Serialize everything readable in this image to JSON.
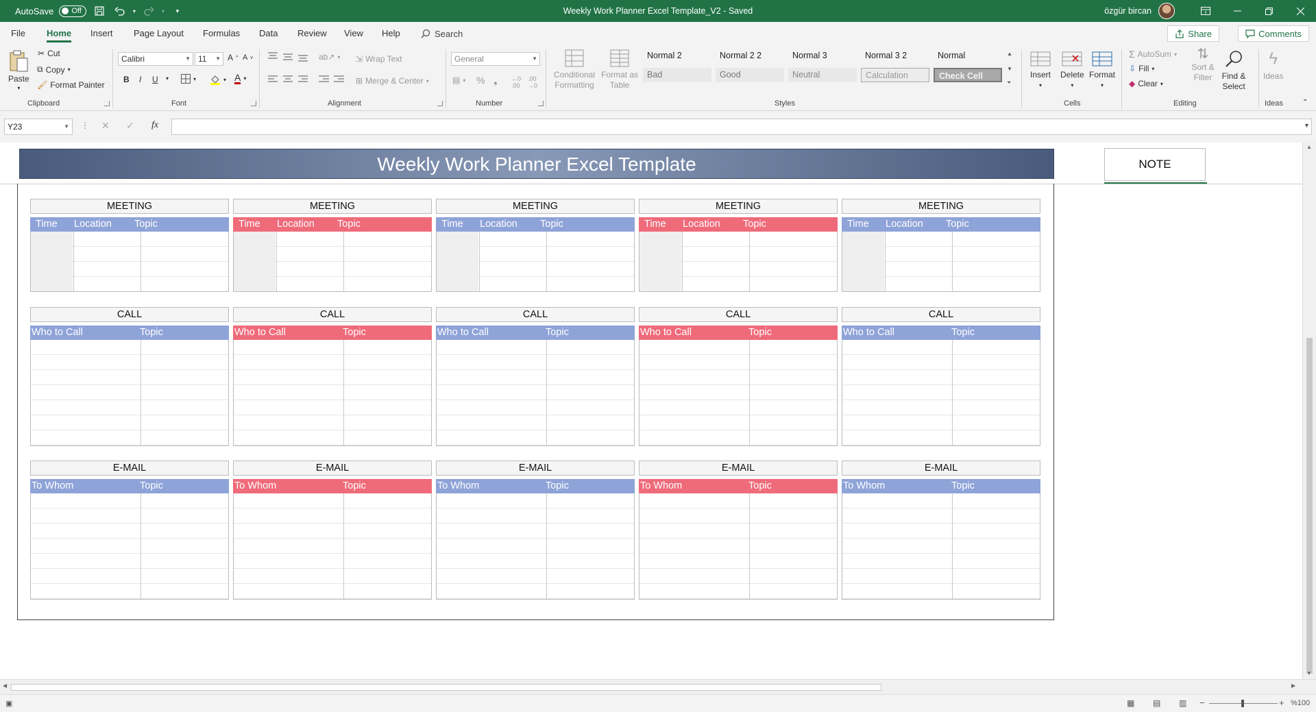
{
  "titlebar": {
    "autosave_label": "AutoSave",
    "autosave_state": "Off",
    "doc_title": "Weekly Work Planner Excel Template_V2",
    "doc_status": "Saved",
    "user_name": "özgür bircan"
  },
  "menu": {
    "tabs": [
      "File",
      "Home",
      "Insert",
      "Page Layout",
      "Formulas",
      "Data",
      "Review",
      "View",
      "Help"
    ],
    "active_tab": "Home",
    "search_label": "Search",
    "share_label": "Share",
    "comments_label": "Comments"
  },
  "ribbon": {
    "clipboard": {
      "paste": "Paste",
      "cut": "Cut",
      "copy": "Copy",
      "format_painter": "Format Painter",
      "label": "Clipboard"
    },
    "font": {
      "name": "Calibri",
      "size": "11",
      "bold": "B",
      "italic": "I",
      "underline": "U",
      "label": "Font"
    },
    "alignment": {
      "wrap_text": "Wrap Text",
      "merge_center": "Merge & Center",
      "label": "Alignment"
    },
    "number": {
      "format": "General",
      "label": "Number"
    },
    "styles": {
      "conditional_formatting": "Conditional Formatting",
      "format_as_table": "Format as Table",
      "cells": [
        {
          "name": "Normal 2",
          "bg": "#f3f3f3",
          "color": "#333"
        },
        {
          "name": "Normal 2 2",
          "bg": "#f3f3f3",
          "color": "#333"
        },
        {
          "name": "Normal 3",
          "bg": "#f3f3f3",
          "color": "#333"
        },
        {
          "name": "Normal 3 2",
          "bg": "#f3f3f3",
          "color": "#333"
        },
        {
          "name": "Normal",
          "bg": "#f3f3f3",
          "color": "#333"
        },
        {
          "name": "Bad",
          "bg": "#e8e8e8",
          "color": "#777"
        },
        {
          "name": "Good",
          "bg": "#e8e8e8",
          "color": "#777"
        },
        {
          "name": "Neutral",
          "bg": "#e8e8e8",
          "color": "#888"
        },
        {
          "name": "Calculation",
          "bg": "#ececec",
          "color": "#999"
        },
        {
          "name": "Check Cell",
          "bg": "#a8a8a8",
          "color": "#f3f3f3"
        }
      ],
      "label": "Styles"
    },
    "cells": {
      "insert": "Insert",
      "delete": "Delete",
      "format": "Format",
      "label": "Cells"
    },
    "editing": {
      "autosum": "AutoSum",
      "fill": "Fill",
      "clear": "Clear",
      "sort_filter": "Sort & Filter",
      "find_select": "Find & Select",
      "label": "Editing"
    },
    "ideas": {
      "ideas": "Ideas",
      "label": "Ideas"
    }
  },
  "formula_bar": {
    "name_box": "Y23",
    "fx": "fx",
    "content": ""
  },
  "sheet": {
    "banner_title": "Weekly Work Planner Excel Template",
    "note_label": "NOTE",
    "meeting": {
      "title": "MEETING",
      "cols": [
        "Time",
        "Location",
        "Topic"
      ]
    },
    "call": {
      "title": "CALL",
      "cols": [
        "Who to Call",
        "Topic"
      ]
    },
    "email": {
      "title": "E-MAIL",
      "cols": [
        "To Whom",
        "Topic"
      ]
    },
    "day_colors": [
      "blue",
      "red",
      "blue",
      "red",
      "blue"
    ]
  },
  "status": {
    "zoom": "%100"
  },
  "colors": {
    "excel_green": "#217346",
    "header_blue": "#8ea3d8",
    "header_red": "#ef6b7a"
  }
}
